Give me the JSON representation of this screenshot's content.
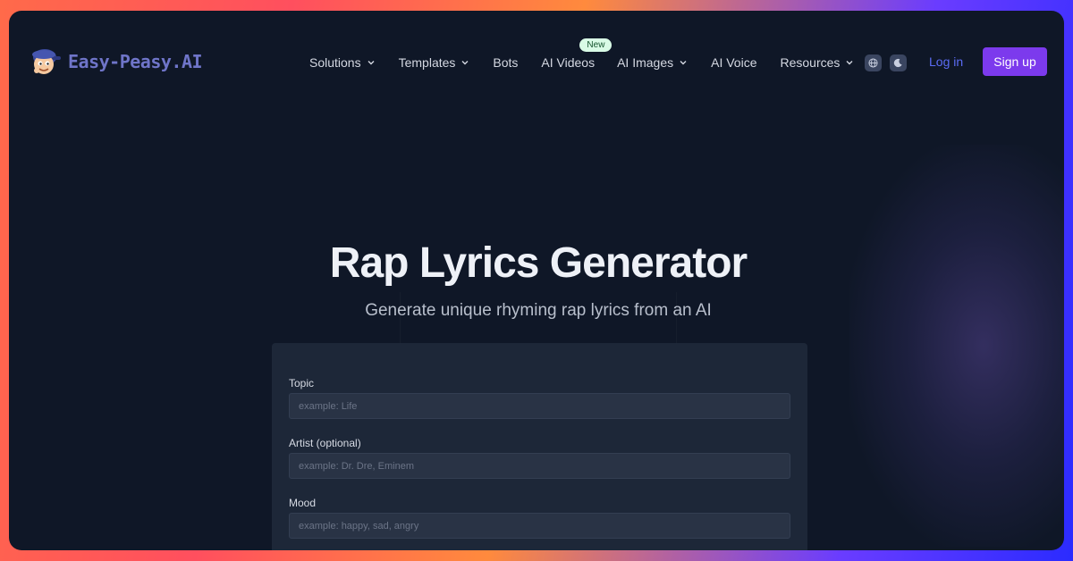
{
  "brand": {
    "name": "Easy-Peasy.AI"
  },
  "nav": {
    "items": [
      {
        "label": "Solutions",
        "dropdown": true
      },
      {
        "label": "Templates",
        "dropdown": true
      },
      {
        "label": "Bots",
        "dropdown": false
      },
      {
        "label": "AI Videos",
        "dropdown": false,
        "badge": "New"
      },
      {
        "label": "AI Images",
        "dropdown": true
      },
      {
        "label": "AI Voice",
        "dropdown": false
      },
      {
        "label": "Resources",
        "dropdown": true
      }
    ],
    "globe_icon": "globe-icon",
    "theme_icon": "moon-icon",
    "login_label": "Log in",
    "signup_label": "Sign up"
  },
  "hero": {
    "title": "Rap Lyrics Generator",
    "subtitle": "Generate unique rhyming rap lyrics from an AI"
  },
  "form": {
    "fields": [
      {
        "label": "Topic",
        "placeholder": "example: Life",
        "value": ""
      },
      {
        "label": "Artist (optional)",
        "placeholder": "example: Dr. Dre, Eminem",
        "value": ""
      },
      {
        "label": "Mood",
        "placeholder": "example: happy, sad, angry",
        "value": ""
      }
    ]
  },
  "colors": {
    "accent": "#7c3aed",
    "login": "#5b6cf5",
    "brand_text": "#6f75c9",
    "background": "#0f1727",
    "badge_bg": "#d9fbe6"
  }
}
